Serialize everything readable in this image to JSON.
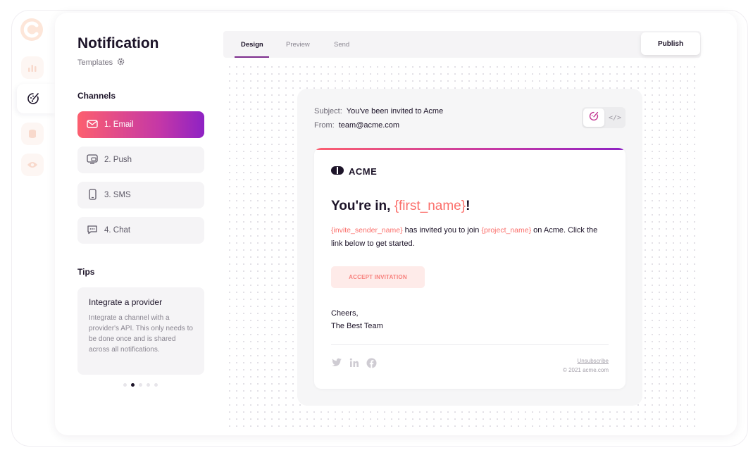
{
  "app": {
    "title": "Notification",
    "templates_label": "Templates"
  },
  "rail": {
    "items": [
      "logo-icon",
      "analytics-icon",
      "design-icon",
      "database-icon",
      "eye-icon"
    ]
  },
  "channels": {
    "heading": "Channels",
    "items": [
      {
        "label": "1. Email",
        "icon": "mail-icon"
      },
      {
        "label": "2. Push",
        "icon": "push-icon"
      },
      {
        "label": "3. SMS",
        "icon": "phone-icon"
      },
      {
        "label": "4. Chat",
        "icon": "chat-icon"
      }
    ],
    "active_index": 0
  },
  "tips": {
    "heading": "Tips",
    "card_title": "Integrate a provider",
    "card_text": "Integrate a channel with a provider's API. This only needs to be done once and is shared across all notifications.",
    "page_count": 5,
    "active_page": 2
  },
  "tabs": {
    "items": [
      "Design",
      "Preview",
      "Send"
    ],
    "active": "Design",
    "publish_label": "Publish"
  },
  "preview": {
    "subject_key": "Subject:",
    "subject_value": "You've been invited to Acme",
    "from_key": "From:",
    "from_value": "team@acme.com",
    "code_toggle_label": "</>",
    "email": {
      "brand": "ACME",
      "headline_prefix": "You're in, ",
      "headline_var": "{first_name}",
      "headline_suffix": "!",
      "body_var1": "{invite_sender_name}",
      "body_mid": " has invited you to join ",
      "body_var2": "{project_name}",
      "body_end": " on Acme. Click the link below to get started.",
      "cta": "ACCEPT INVITATION",
      "signoff_line1": "Cheers,",
      "signoff_line2": "The Best Team",
      "unsubscribe": "Unsubscribe",
      "copyright": "© 2021 acme.com",
      "social_icons": [
        "twitter-icon",
        "linkedin-icon",
        "facebook-icon"
      ]
    }
  },
  "colors": {
    "accent_gradient_start": "#fc5f6f",
    "accent_gradient_end": "#8e22c4",
    "variable_text": "#fb6e6a",
    "cta_bg": "#feebe9",
    "rail_tint": "#fdf6f3"
  }
}
